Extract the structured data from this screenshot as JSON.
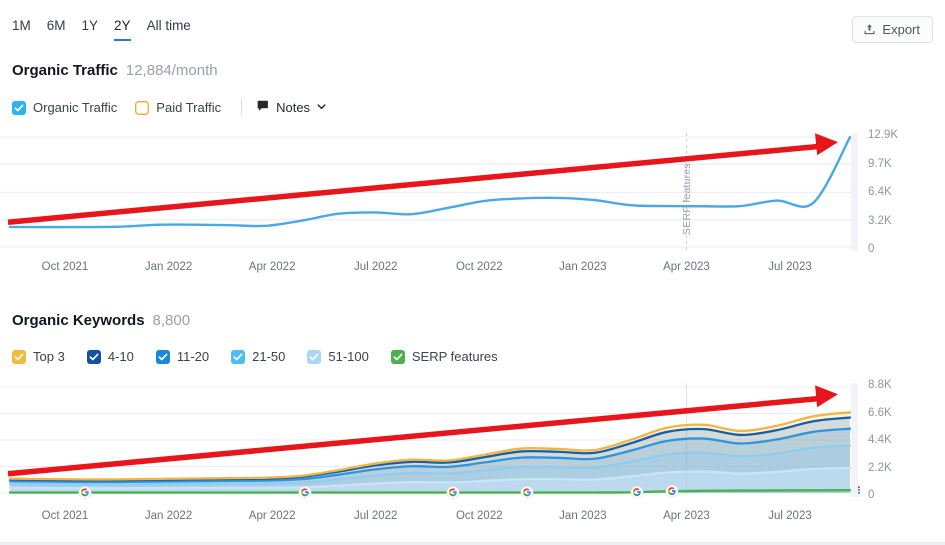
{
  "toolbar": {
    "periods": [
      {
        "label": "1M",
        "active": false
      },
      {
        "label": "6M",
        "active": false
      },
      {
        "label": "1Y",
        "active": false
      },
      {
        "label": "2Y",
        "active": true
      },
      {
        "label": "All time",
        "active": false
      }
    ],
    "export_label": "Export",
    "export_icon": "upload-icon",
    "active_underline_color": "#1f7ae0"
  },
  "traffic_section": {
    "title": "Organic Traffic",
    "value": "12,884/month",
    "legend": [
      {
        "label": "Organic Traffic",
        "checked": true,
        "color": "#2bb3f3",
        "name": "organic-traffic"
      },
      {
        "label": "Paid Traffic",
        "checked": false,
        "color": "#f5a623",
        "name": "paid-traffic"
      }
    ],
    "notes_label": "Notes",
    "notes_icon": "flag-icon",
    "chevron_icon": "chevron-down-icon"
  },
  "keywords_section": {
    "title": "Organic Keywords",
    "value": "8,800",
    "legend": [
      {
        "label": "Top 3",
        "checked": true,
        "color": "#f5b942",
        "name": "top-3"
      },
      {
        "label": "4-10",
        "checked": true,
        "color": "#10529e",
        "name": "4-10"
      },
      {
        "label": "11-20",
        "checked": true,
        "color": "#1a86e0",
        "name": "11-20"
      },
      {
        "label": "21-50",
        "checked": true,
        "color": "#4fbdf0",
        "name": "21-50"
      },
      {
        "label": "51-100",
        "checked": true,
        "color": "#a8d8f5",
        "name": "51-100"
      },
      {
        "label": "SERP features",
        "checked": true,
        "color": "#4caf50",
        "name": "serp-features"
      }
    ]
  },
  "chart_data": [
    {
      "type": "line",
      "name": "organic-traffic-chart",
      "title": "Organic Traffic",
      "xlabel": "",
      "ylabel": "",
      "grid": true,
      "legend_position": "top",
      "ylim": [
        0,
        12900
      ],
      "ytick_labels": [
        "12.9K",
        "9.7K",
        "6.4K",
        "3.2K",
        "0"
      ],
      "ytick_values": [
        12900,
        9700,
        6400,
        3200,
        0
      ],
      "xtick_labels": [
        "Oct 2021",
        "Jan 2022",
        "Apr 2022",
        "Jul 2022",
        "Oct 2022",
        "Jan 2023",
        "Apr 2023",
        "Jul 2023"
      ],
      "annotations": [
        {
          "type": "vline",
          "label": "SERP features",
          "x_label": "Apr 2023",
          "style": "dashed"
        },
        {
          "type": "arrow",
          "label": "uptrend-arrow",
          "color": "#e8161a",
          "from": [
            0,
            2900
          ],
          "to": [
            12900,
            12300
          ]
        }
      ],
      "series": [
        {
          "name": "Organic Traffic",
          "color": "#4aa8e8",
          "x": [
            "2021-09",
            "2021-10",
            "2021-11",
            "2021-12",
            "2022-01",
            "2022-02",
            "2022-03",
            "2022-04",
            "2022-05",
            "2022-06",
            "2022-07",
            "2022-08",
            "2022-09",
            "2022-10",
            "2022-11",
            "2022-12",
            "2023-01",
            "2023-02",
            "2023-03",
            "2023-04",
            "2023-05",
            "2023-06",
            "2023-07",
            "2023-08"
          ],
          "values": [
            2350,
            2330,
            2340,
            2380,
            2600,
            2620,
            2560,
            2480,
            3100,
            3900,
            4050,
            3850,
            4600,
            5400,
            5700,
            5750,
            5500,
            4900,
            4800,
            4780,
            4800,
            5450,
            5200,
            12884
          ]
        }
      ]
    },
    {
      "type": "area",
      "name": "organic-keywords-chart",
      "title": "Organic Keywords",
      "stacked": true,
      "xlabel": "",
      "ylabel": "",
      "grid": true,
      "legend_position": "top",
      "ylim": [
        0,
        8800
      ],
      "ytick_labels": [
        "8.8K",
        "6.6K",
        "4.4K",
        "2.2K",
        "0"
      ],
      "ytick_values": [
        8800,
        6600,
        4400,
        2200,
        0
      ],
      "xtick_labels": [
        "Oct 2021",
        "Jan 2022",
        "Apr 2022",
        "Jul 2022",
        "Oct 2022",
        "Jan 2023",
        "Apr 2023",
        "Jul 2023"
      ],
      "annotations": [
        {
          "type": "arrow",
          "label": "uptrend-arrow",
          "color": "#e8161a",
          "from": [
            0,
            1600
          ],
          "to": [
            8800,
            8200
          ]
        },
        {
          "type": "marker",
          "label": "google-update-marker",
          "icon": "google-g-icon",
          "count": 7
        }
      ],
      "x": [
        "2021-09",
        "2021-10",
        "2021-11",
        "2021-12",
        "2022-01",
        "2022-02",
        "2022-03",
        "2022-04",
        "2022-05",
        "2022-06",
        "2022-07",
        "2022-08",
        "2022-09",
        "2022-10",
        "2022-11",
        "2022-12",
        "2023-01",
        "2023-02",
        "2023-03",
        "2023-04",
        "2023-05",
        "2023-06",
        "2023-07",
        "2023-08"
      ],
      "series": [
        {
          "name": "51-100",
          "color": "#c7e4f8",
          "values": [
            420,
            400,
            390,
            390,
            400,
            410,
            420,
            430,
            470,
            610,
            780,
            900,
            880,
            1000,
            1150,
            1150,
            1120,
            1380,
            1700,
            1780,
            1620,
            1750,
            2000,
            2100
          ]
        },
        {
          "name": "21-50",
          "color": "#8fcdf2",
          "values": [
            330,
            320,
            310,
            310,
            320,
            330,
            340,
            350,
            390,
            520,
            680,
            760,
            740,
            880,
            1020,
            1010,
            980,
            1220,
            1500,
            1560,
            1420,
            1540,
            1760,
            1850
          ]
        },
        {
          "name": "11-20",
          "color": "#2b95e3",
          "values": [
            230,
            225,
            220,
            220,
            230,
            235,
            245,
            250,
            290,
            390,
            500,
            560,
            550,
            660,
            770,
            760,
            740,
            920,
            1130,
            1180,
            1070,
            1160,
            1320,
            1390
          ]
        },
        {
          "name": "4-10",
          "color": "#1560a8",
          "values": [
            150,
            148,
            145,
            145,
            150,
            155,
            160,
            165,
            190,
            260,
            330,
            370,
            360,
            440,
            510,
            505,
            490,
            610,
            750,
            780,
            710,
            770,
            880,
            925
          ]
        },
        {
          "name": "Top 3",
          "color": "#f2b544",
          "values": [
            70,
            68,
            66,
            66,
            70,
            72,
            75,
            78,
            90,
            120,
            155,
            175,
            170,
            205,
            240,
            238,
            230,
            285,
            350,
            365,
            333,
            360,
            410,
            435
          ]
        },
        {
          "name": "SERP features",
          "color": "#4caf50",
          "values": [
            40,
            40,
            40,
            40,
            40,
            40,
            40,
            40,
            40,
            40,
            40,
            40,
            40,
            40,
            40,
            40,
            40,
            60,
            140,
            185,
            200,
            210,
            220,
            230
          ]
        }
      ]
    }
  ]
}
